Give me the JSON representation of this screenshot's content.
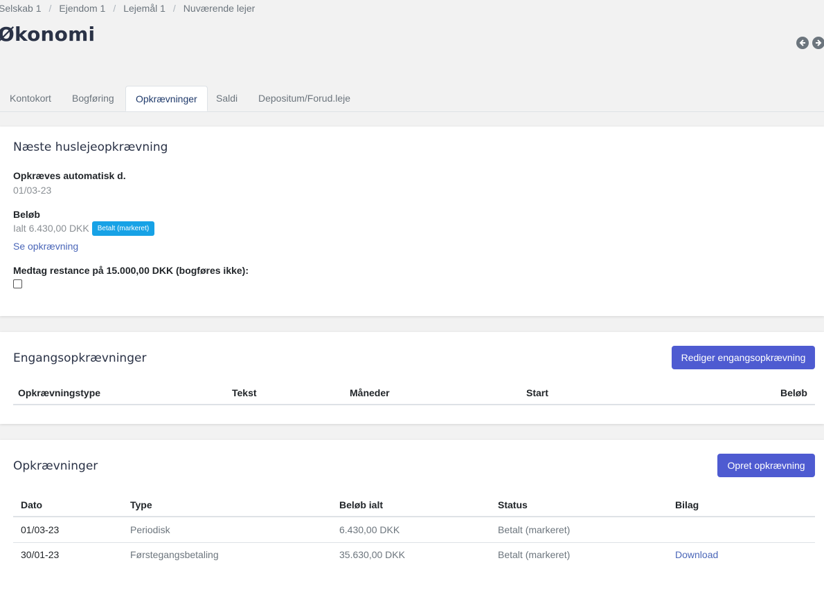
{
  "breadcrumb": [
    "Selskab 1",
    "Ejendom 1",
    "Lejemål 1",
    "Nuværende lejer"
  ],
  "page_title": "Økonomi",
  "tabs": [
    {
      "label": "Kontokort"
    },
    {
      "label": "Bogføring"
    },
    {
      "label": "Opkrævninger",
      "active": true
    },
    {
      "label": "Saldi"
    },
    {
      "label": "Depositum/Forud.leje"
    }
  ],
  "next_charge": {
    "title": "Næste huslejeopkrævning",
    "date_label": "Opkræves automatisk d.",
    "date_value": "01/03-23",
    "amount_label": "Beløb",
    "amount_value": "Ialt 6.430,00 DKK",
    "badge": "Betalt (markeret)",
    "see_link": "Se opkrævning",
    "arrears_label": "Medtag restance på 15.000,00 DKK (bogføres ikke):",
    "arrears_checked": false
  },
  "one_time": {
    "title": "Engangsopkrævninger",
    "button": "Rediger engangsopkrævning",
    "columns": [
      "Opkrævningstype",
      "Tekst",
      "Måneder",
      "Start",
      "Beløb"
    ]
  },
  "charges": {
    "title": "Opkrævninger",
    "button": "Opret opkrævning",
    "columns": [
      "Dato",
      "Type",
      "Beløb ialt",
      "Status",
      "Bilag"
    ],
    "rows": [
      {
        "date": "01/03-23",
        "type": "Periodisk",
        "amount": "6.430,00 DKK",
        "status": "Betalt (markeret)",
        "attachment": ""
      },
      {
        "date": "30/01-23",
        "type": "Førstegangsbetaling",
        "amount": "35.630,00 DKK",
        "status": "Betalt (markeret)",
        "attachment": "Download"
      }
    ]
  },
  "icons": {
    "back": "arrow-left-circle-icon",
    "forward": "arrow-right-circle-icon"
  },
  "colors": {
    "primary_button": "#4e5bd1",
    "badge": "#17a2e6",
    "link": "#4a66b8",
    "title": "#2a3246"
  }
}
